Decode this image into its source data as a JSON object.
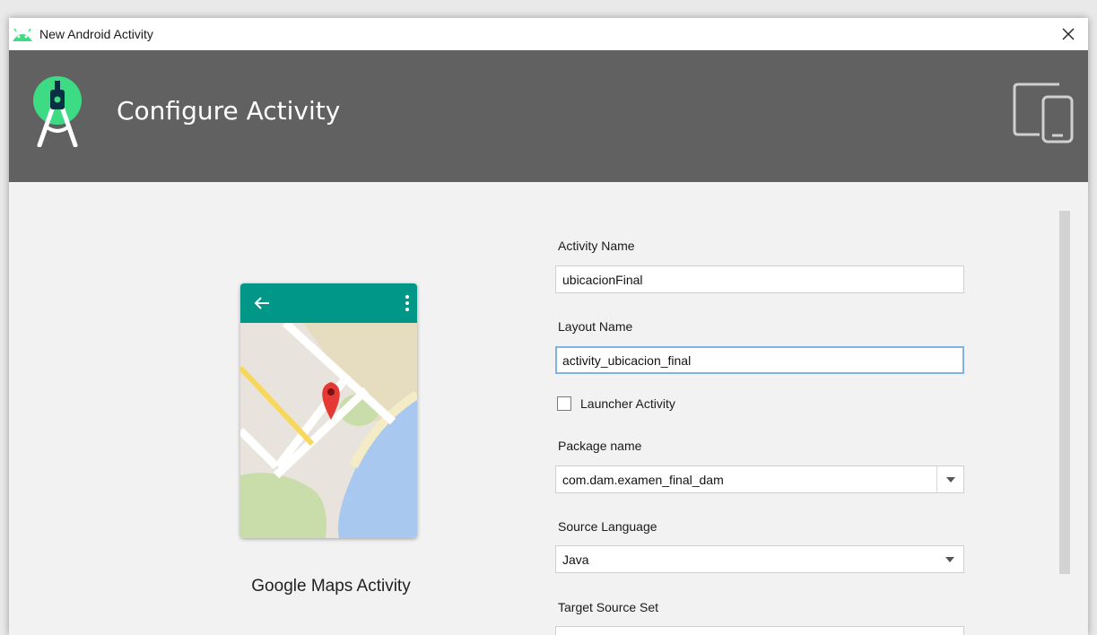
{
  "window": {
    "title": "New Android Activity",
    "close_icon": "close-icon",
    "app_icon": "android-icon"
  },
  "banner": {
    "title": "Configure Activity",
    "logo": "android-studio-logo",
    "devices_icon": "devices-icon",
    "background": "#616161"
  },
  "preview": {
    "label": "Google Maps Activity",
    "bar_color": "#009688",
    "pin_color": "#e53935"
  },
  "form": {
    "activity_name": {
      "label": "Activity Name",
      "value": "ubicacionFinal"
    },
    "layout_name": {
      "label": "Layout Name",
      "value": "activity_ubicacion_final"
    },
    "launcher_activity": {
      "label": "Launcher Activity",
      "checked": false
    },
    "package_name": {
      "label": "Package name",
      "value": "com.dam.examen_final_dam"
    },
    "source_language": {
      "label": "Source Language",
      "value": "Java"
    },
    "target_source_set": {
      "label": "Target Source Set"
    }
  }
}
